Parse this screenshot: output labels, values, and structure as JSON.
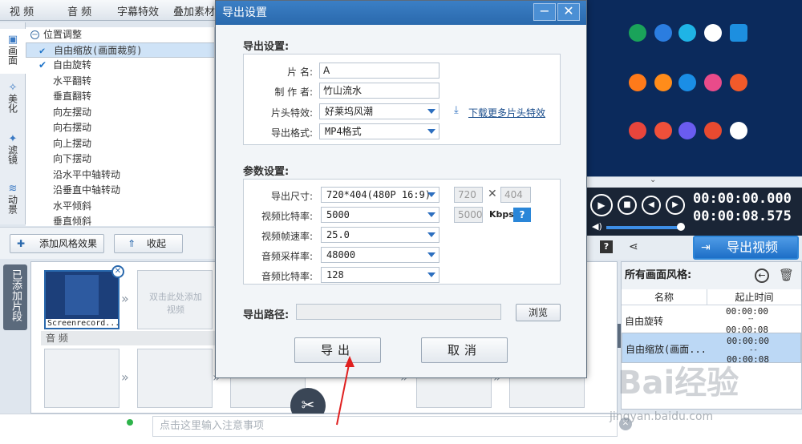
{
  "menu": [
    "视 频",
    "音 频",
    "字幕特效",
    "叠加素材"
  ],
  "left_tabs": [
    {
      "label": "画面",
      "icon": "layout-icon"
    },
    {
      "label": "美化",
      "icon": "magic-wand-icon"
    },
    {
      "label": "滤镜",
      "icon": "sparkle-icon"
    },
    {
      "label": "动景",
      "icon": "wave-icon"
    }
  ],
  "tree": {
    "group": "位置调整",
    "items": [
      {
        "label": "自由缩放(画面裁剪)",
        "checked": true,
        "selected": true
      },
      {
        "label": "自由旋转",
        "checked": true,
        "selected": false
      },
      {
        "label": "水平翻转",
        "checked": false
      },
      {
        "label": "垂直翻转",
        "checked": false
      },
      {
        "label": "向左摆动",
        "checked": false
      },
      {
        "label": "向右摆动",
        "checked": false
      },
      {
        "label": "向上摆动",
        "checked": false
      },
      {
        "label": "向下摆动",
        "checked": false
      },
      {
        "label": "沿水平中轴转动",
        "checked": false
      },
      {
        "label": "沿垂直中轴转动",
        "checked": false
      },
      {
        "label": "水平倾斜",
        "checked": false
      },
      {
        "label": "垂直倾斜",
        "checked": false
      }
    ]
  },
  "buttons": {
    "add_style": "添加风格效果",
    "collapse": "收起"
  },
  "player": {
    "time_current": "00:00:00.000",
    "time_total": "00:00:08.575",
    "export_video": "导出视频"
  },
  "style_panel": {
    "title": "所有画面风格:",
    "col_name": "名称",
    "col_time": "起止时间",
    "rows": [
      {
        "name": "自由旋转",
        "start": "00:00:00",
        "sep": "--",
        "end": "00:00:08",
        "selected": false
      },
      {
        "name": "自由缩放(画面...",
        "start": "00:00:00",
        "sep": "--",
        "end": "00:00:08",
        "selected": true
      }
    ]
  },
  "timeline": {
    "side_label": "已添加片段",
    "clip_name": "Screenrecord...",
    "placeholder": "双击此处添加视频",
    "audio_label": "音 频"
  },
  "notes_placeholder": "点击这里输入注意事项",
  "dialog": {
    "title": "导出设置",
    "section1": "导出设置:",
    "name_label": "片 名:",
    "name_value": "A",
    "author_label": "制 作 者:",
    "author_value": "竹山流水",
    "intro_label": "片头特效:",
    "intro_value": "好莱坞风潮",
    "download_link": "下载更多片头特效",
    "format_label": "导出格式:",
    "format_value": "MP4格式",
    "section2": "参数设置:",
    "size_label": "导出尺寸:",
    "size_value": "720*404(480P 16:9)",
    "width_value": "720",
    "height_value": "404",
    "vbitrate_label": "视频比特率:",
    "vbitrate_value": "5000",
    "vbitrate_custom": "5000",
    "kbps": "Kbps",
    "fps_label": "视频帧速率:",
    "fps_value": "25.0",
    "samplerate_label": "音频采样率:",
    "samplerate_value": "48000",
    "abitrate_label": "音频比特率:",
    "abitrate_value": "128",
    "path_label": "导出路径:",
    "path_value": "",
    "browse": "浏览",
    "export": "导出",
    "cancel": "取消"
  },
  "colors": {
    "accent": "#2a69ad",
    "selection": "#cfe3f7",
    "preview_bg": "#0b2a5c",
    "arrow_red": "#e02020"
  },
  "watermark": {
    "brand": "Bai经验",
    "url": "jingyan.baidu.com"
  }
}
